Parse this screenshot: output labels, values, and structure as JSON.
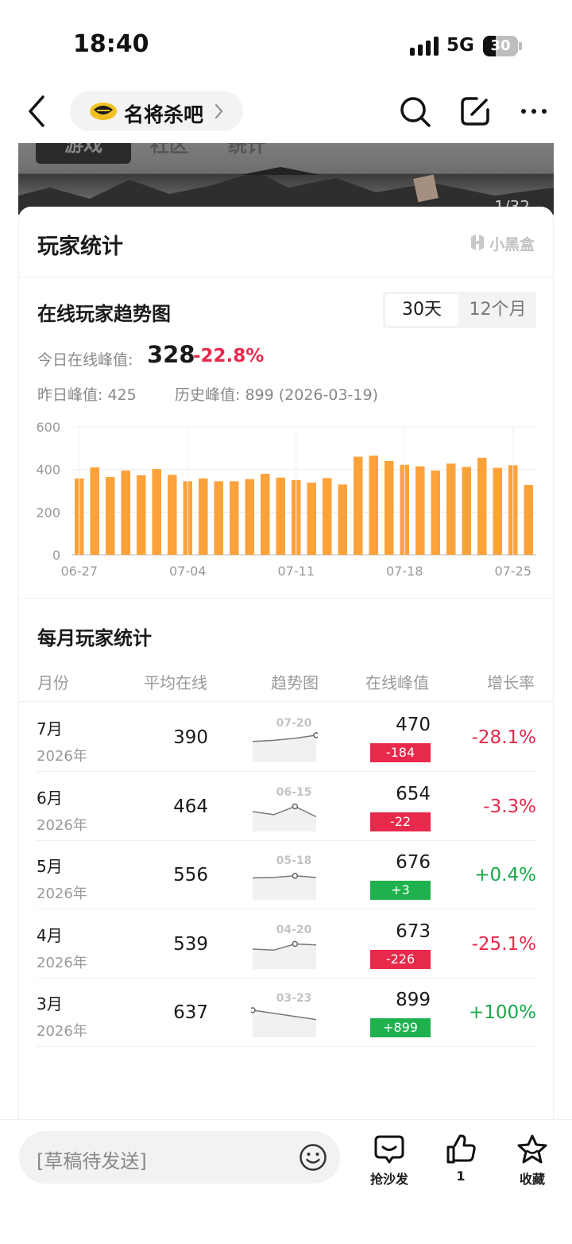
{
  "status_bar": {
    "time": "18:40",
    "network": "5G",
    "battery": "30"
  },
  "nav": {
    "forum_name": "名将杀吧"
  },
  "banner": {
    "tabs": [
      "游戏",
      "社区",
      "统计"
    ],
    "image_counter": "1/32"
  },
  "card": {
    "title": "玩家统计",
    "brand": "小黑盒"
  },
  "trend": {
    "title": "在线玩家趋势图",
    "range_options": [
      "30天",
      "12个月"
    ],
    "selected_range": "30天",
    "today_peak_label": "今日在线峰值:",
    "today_peak_value": "328",
    "today_peak_change": "-22.8%",
    "yesterday_peak": "昨日峰值: 425",
    "history_peak": "历史峰值: 899 (2026-03-19)"
  },
  "chart_data": {
    "type": "bar",
    "x": [
      "06-27",
      "06-28",
      "06-29",
      "06-30",
      "07-01",
      "07-02",
      "07-03",
      "07-04",
      "07-05",
      "07-06",
      "07-07",
      "07-08",
      "07-09",
      "07-10",
      "07-11",
      "07-12",
      "07-13",
      "07-14",
      "07-15",
      "07-16",
      "07-17",
      "07-18",
      "07-19",
      "07-20",
      "07-21",
      "07-22",
      "07-23",
      "07-24",
      "07-25",
      "07-26"
    ],
    "values": [
      358,
      410,
      365,
      395,
      373,
      402,
      375,
      345,
      358,
      345,
      345,
      355,
      380,
      362,
      350,
      338,
      360,
      330,
      460,
      465,
      440,
      422,
      415,
      395,
      428,
      412,
      455,
      408,
      420,
      328
    ],
    "x_ticks": [
      "06-27",
      "07-04",
      "07-11",
      "07-18",
      "07-25"
    ],
    "y_ticks": [
      0,
      200,
      400,
      600
    ],
    "ylim": [
      0,
      600
    ],
    "color": "#fca23b",
    "grid": true
  },
  "monthly": {
    "title": "每月玩家统计",
    "headers": {
      "month": "月份",
      "avg": "平均在线",
      "trend": "趋势图",
      "peak": "在线峰值",
      "growth": "增长率"
    },
    "rows": [
      {
        "month": "7月",
        "year": "2026年",
        "avg": "390",
        "spark_label": "07-20",
        "peak": "470",
        "delta": "-184",
        "growth": "-28.1%",
        "positive": false,
        "spark": [
          0.55,
          0.6,
          0.7,
          0.85
        ],
        "marker": 3
      },
      {
        "month": "6月",
        "year": "2026年",
        "avg": "464",
        "spark_label": "06-15",
        "peak": "654",
        "delta": "-22",
        "growth": "-3.3%",
        "positive": false,
        "spark": [
          0.5,
          0.35,
          0.75,
          0.25
        ],
        "marker": 2
      },
      {
        "month": "5月",
        "year": "2026年",
        "avg": "556",
        "spark_label": "05-18",
        "peak": "676",
        "delta": "+3",
        "growth": "+0.4%",
        "positive": true,
        "spark": [
          0.6,
          0.62,
          0.7,
          0.62
        ],
        "marker": 2
      },
      {
        "month": "4月",
        "year": "2026年",
        "avg": "539",
        "spark_label": "04-20",
        "peak": "673",
        "delta": "-226",
        "growth": "-25.1%",
        "positive": false,
        "spark": [
          0.5,
          0.45,
          0.75,
          0.7
        ],
        "marker": 2
      },
      {
        "month": "3月",
        "year": "2026年",
        "avg": "637",
        "spark_label": "03-23",
        "peak": "899",
        "delta": "+899",
        "growth": "+100%",
        "positive": true,
        "spark": [
          0.85,
          0.7,
          0.55,
          0.4
        ],
        "marker": 0
      }
    ]
  },
  "bottom": {
    "draft_placeholder": "[草稿待发送]",
    "actions": [
      {
        "label": "抢沙发",
        "icon": "comment-icon"
      },
      {
        "label": "1",
        "icon": "thumbs-up-icon"
      },
      {
        "label": "收藏",
        "icon": "star-icon"
      }
    ]
  }
}
